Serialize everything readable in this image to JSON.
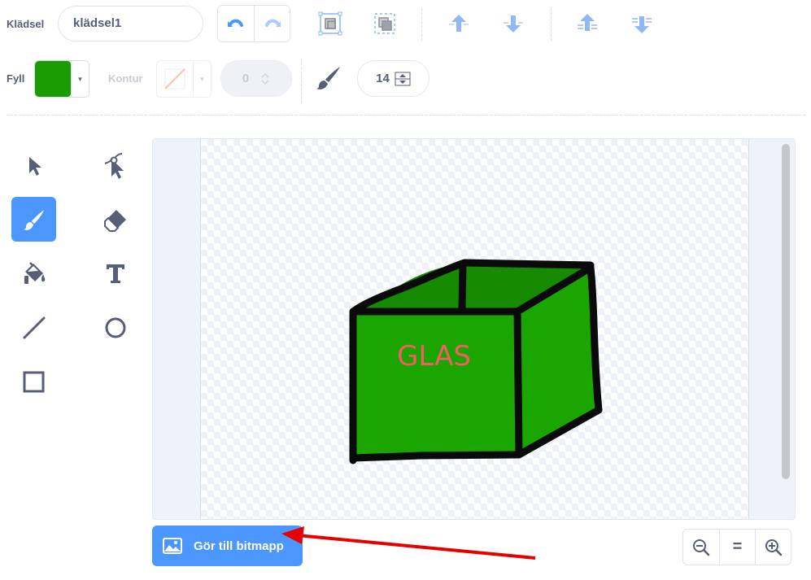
{
  "toolbar": {
    "costume_label": "Klädsel",
    "costume_name": "klädsel1",
    "fill_label": "Fyll",
    "fill_color": "#1a9c00",
    "outline_label": "Kontur",
    "outline_width": "0",
    "brush_size": "14",
    "dropdown_arrow": "▾"
  },
  "drawing": {
    "text": "GLAS",
    "text_color": "#f06060",
    "fill_color": "#1aa500",
    "top_fill_color": "#168a00"
  },
  "bottom": {
    "convert_label": "Gör till bitmapp",
    "zoom_reset": "="
  },
  "accent": "#4c97ff",
  "annotation_color": "#e60000"
}
